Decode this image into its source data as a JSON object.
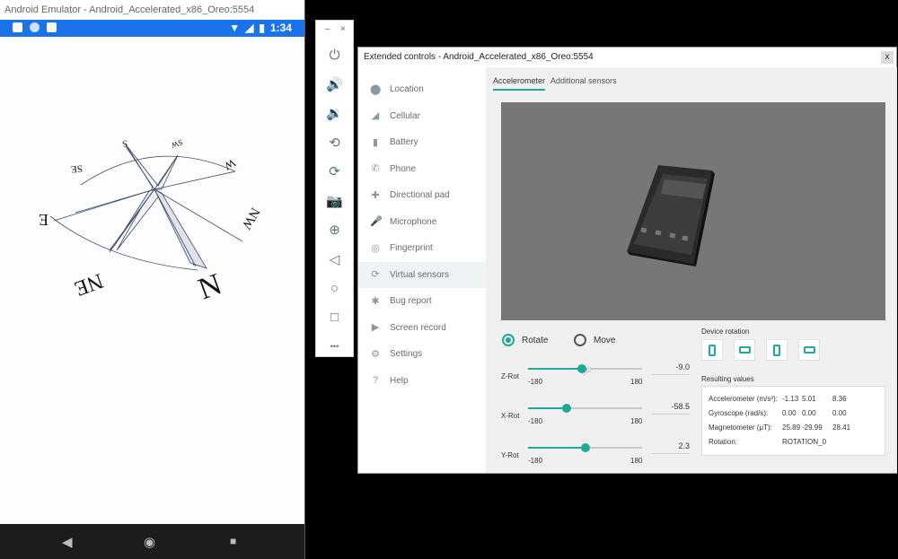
{
  "emulator": {
    "window_title": "Android Emulator - Android_Accelerated_x86_Oreo:5554",
    "status_bar": {
      "time": "1:34"
    },
    "nav": {
      "back": "◀",
      "home": "◉",
      "recents": "■"
    },
    "compass": {
      "n": "N",
      "ne": "NE",
      "e": "E",
      "se": "SE",
      "s": "S",
      "sw": "SW",
      "w": "W",
      "nw": "NW"
    }
  },
  "toolbar": {
    "minimize": "–",
    "close": "×",
    "buttons": [
      {
        "name": "power-icon",
        "glyph": "⏻"
      },
      {
        "name": "volume-up-icon",
        "glyph": "🔊"
      },
      {
        "name": "volume-down-icon",
        "glyph": "🔉"
      },
      {
        "name": "rotate-left-icon",
        "glyph": "⟲"
      },
      {
        "name": "rotate-right-icon",
        "glyph": "⟳"
      },
      {
        "name": "camera-icon",
        "glyph": "📷"
      },
      {
        "name": "zoom-icon",
        "glyph": "⊕"
      },
      {
        "name": "back-icon",
        "glyph": "◁"
      },
      {
        "name": "home-icon",
        "glyph": "○"
      },
      {
        "name": "overview-icon",
        "glyph": "□"
      },
      {
        "name": "more-icon",
        "glyph": "•••"
      }
    ]
  },
  "extended": {
    "title": "Extended controls - Android_Accelerated_x86_Oreo:5554",
    "close": "x",
    "sidebar": [
      {
        "label": "Location",
        "icon": "location-pin-icon",
        "glyph": "⬤"
      },
      {
        "label": "Cellular",
        "icon": "cellular-icon",
        "glyph": "◢"
      },
      {
        "label": "Battery",
        "icon": "battery-icon",
        "glyph": "▮"
      },
      {
        "label": "Phone",
        "icon": "phone-icon",
        "glyph": "✆"
      },
      {
        "label": "Directional pad",
        "icon": "dpad-icon",
        "glyph": "✚"
      },
      {
        "label": "Microphone",
        "icon": "microphone-icon",
        "glyph": "🎤"
      },
      {
        "label": "Fingerprint",
        "icon": "fingerprint-icon",
        "glyph": "◎"
      },
      {
        "label": "Virtual sensors",
        "icon": "virtual-sensors-icon",
        "glyph": "⟳"
      },
      {
        "label": "Bug report",
        "icon": "bug-icon",
        "glyph": "✱"
      },
      {
        "label": "Screen record",
        "icon": "video-icon",
        "glyph": "▶"
      },
      {
        "label": "Settings",
        "icon": "settings-gear-icon",
        "glyph": "⚙"
      },
      {
        "label": "Help",
        "icon": "help-icon",
        "glyph": "?"
      }
    ],
    "active_sidebar": "Virtual sensors",
    "tabs": [
      {
        "label": "Accelerometer",
        "active": true
      },
      {
        "label": "Additional sensors",
        "active": false
      }
    ],
    "mode": {
      "rotate": "Rotate",
      "move": "Move",
      "selected": "Rotate"
    },
    "sliders": [
      {
        "label": "Z-Rot",
        "min": "-180",
        "max": "180",
        "value": "-9.0",
        "fraction": 0.475
      },
      {
        "label": "X-Rot",
        "min": "-180",
        "max": "180",
        "value": "-58.5",
        "fraction": 0.338
      },
      {
        "label": "Y-Rot",
        "min": "-180",
        "max": "180",
        "value": "2.3",
        "fraction": 0.506
      }
    ],
    "device_rotation": {
      "title": "Device rotation",
      "options": [
        "portrait",
        "landscape",
        "reverse-portrait",
        "reverse-landscape"
      ]
    },
    "results": {
      "title": "Resulting values",
      "rows": [
        {
          "label": "Accelerometer (m/s²):",
          "values": [
            "-1.13",
            "5.01",
            "8.36"
          ]
        },
        {
          "label": "Gyroscope (rad/s):",
          "values": [
            "0.00",
            "0.00",
            "0.00"
          ]
        },
        {
          "label": "Magnetometer (μT):",
          "values": [
            "25.89",
            "-29.99",
            "28.41"
          ]
        },
        {
          "label": "Rotation:",
          "values": [
            "ROTATION_0"
          ]
        }
      ]
    },
    "accent_color": "#1ea999"
  }
}
